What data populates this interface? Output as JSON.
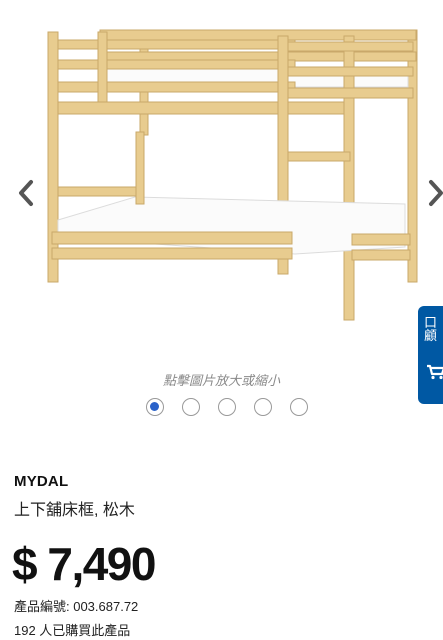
{
  "gallery": {
    "zoom_hint": "點擊圖片放大或縮小",
    "image_count": 5,
    "active_index": 0
  },
  "cart_tab": {
    "glyph_top": "口",
    "glyph_mid": "顧"
  },
  "product": {
    "brand": "MYDAL",
    "description": "上下舖床框, 松木",
    "price": "$ 7,490",
    "article_number": "產品編號: 003.687.72",
    "purchase_count": "192 人已購買此產品"
  },
  "colors": {
    "accent_blue": "#0058a3",
    "active_dot": "#2a62c9",
    "pine_wood": "#e8cc8f"
  },
  "icons": [
    "chevron-left-icon",
    "chevron-right-icon",
    "cart-icon"
  ]
}
